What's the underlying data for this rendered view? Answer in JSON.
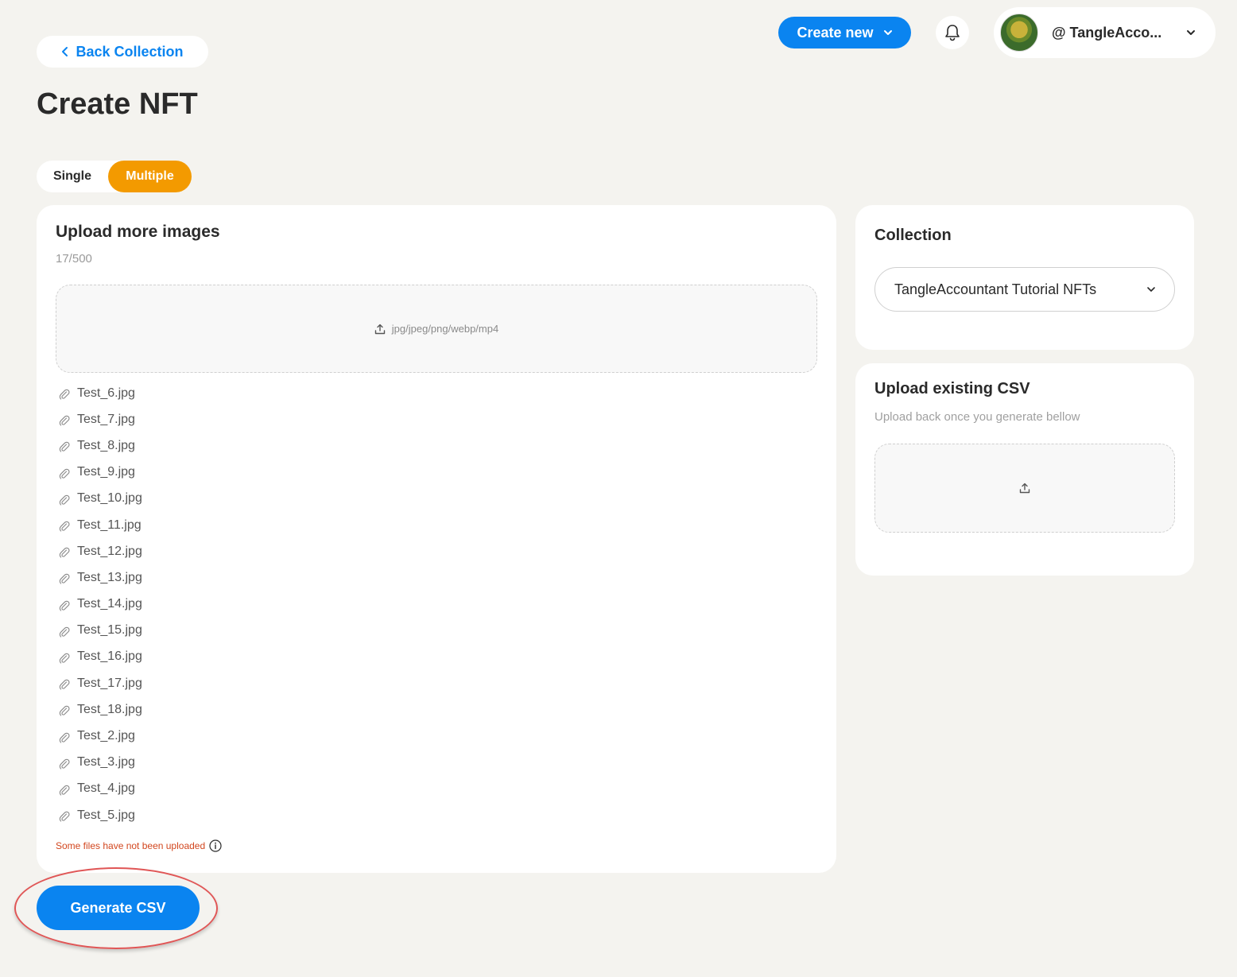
{
  "header": {
    "create_new_label": "Create new",
    "account_name": "@ TangleAcco..."
  },
  "back_label": "Back Collection",
  "page_title": "Create NFT",
  "mode_toggle": {
    "single": "Single",
    "multiple": "Multiple",
    "active": "Multiple"
  },
  "upload": {
    "title": "Upload more images",
    "count": "17/500",
    "dropzone_hint": "jpg/jpeg/png/webp/mp4",
    "files": [
      "Test_6.jpg",
      "Test_7.jpg",
      "Test_8.jpg",
      "Test_9.jpg",
      "Test_10.jpg",
      "Test_11.jpg",
      "Test_12.jpg",
      "Test_13.jpg",
      "Test_14.jpg",
      "Test_15.jpg",
      "Test_16.jpg",
      "Test_17.jpg",
      "Test_18.jpg",
      "Test_2.jpg",
      "Test_3.jpg",
      "Test_4.jpg",
      "Test_5.jpg"
    ],
    "warning": "Some files have not been uploaded"
  },
  "collection": {
    "title": "Collection",
    "selected": "TangleAccountant Tutorial NFTs"
  },
  "csv": {
    "title": "Upload existing CSV",
    "subtitle": "Upload back once you generate bellow"
  },
  "generate_label": "Generate CSV",
  "colors": {
    "accent": "#0a84f0",
    "toggle_active": "#f39a00",
    "warning": "#d2461e",
    "highlight": "#e05656"
  }
}
